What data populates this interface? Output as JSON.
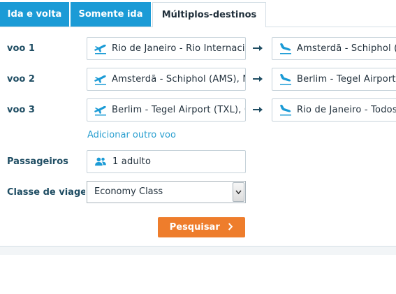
{
  "tabs": [
    {
      "label": "Ida e volta"
    },
    {
      "label": "Somente ida"
    },
    {
      "label": "Múltiplos-destinos"
    }
  ],
  "flights": [
    {
      "label": "voo 1",
      "from": "Rio de Janeiro - Rio Internacional",
      "to": "Amsterdã - Schiphol (AMS)"
    },
    {
      "label": "voo 2",
      "from": "Amsterdã - Schiphol (AMS), Netherlands",
      "to": "Berlim - Tegel Airport (TXL)"
    },
    {
      "label": "voo 3",
      "from": "Berlim - Tegel Airport (TXL), Germany",
      "to": "Rio de Janeiro - Todos"
    }
  ],
  "add_flight_label": "Adicionar outro voo",
  "passengers": {
    "label": "Passageiros",
    "value": "1 adulto"
  },
  "cabin_class": {
    "label": "Classe de viagem",
    "selected": "Economy Class"
  },
  "search_button": "Pesquisar",
  "colors": {
    "tab_active_bg": "#ffffff",
    "tab_bg": "#1b9bd6",
    "accent": "#ee7d2c",
    "icon": "#1b9bd6"
  },
  "icons": {
    "departure": "plane-takeoff-icon",
    "arrival": "plane-landing-icon",
    "route_arrow": "arrow-right-icon",
    "passenger": "people-icon",
    "next": "chevron-right-icon"
  }
}
